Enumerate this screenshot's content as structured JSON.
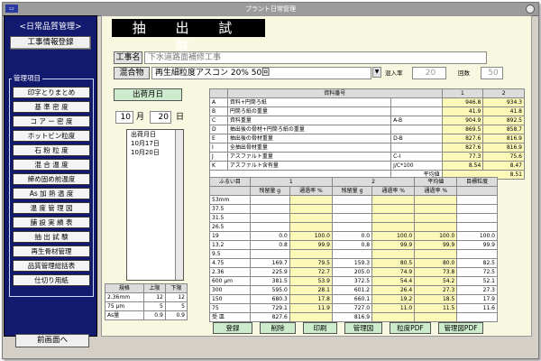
{
  "window": {
    "title": "プラント日常管理"
  },
  "sidebar": {
    "title": "<日常品質管理>",
    "register_button": "工事情報登録",
    "menu_label": "管理項目",
    "items": [
      "印字とりまとめ",
      "基 準 密 度",
      "コ ア ー 密 度",
      "ホットビン粒度",
      "石 粉 粒 度",
      "混 合 温 度",
      "締め固め前温度",
      "As 加 熱 温 度",
      "温 度 管 理 図",
      "舗 設 実 績 表",
      "抽 出 試 験",
      "再生骨材管理",
      "品質管理総括表",
      "仕切り用紙"
    ],
    "back_button": "前画面へ"
  },
  "header": {
    "title": "抽 出 試 験"
  },
  "fields": {
    "construction_label": "工事名",
    "construction_value": "下水道路面補修工事",
    "mix_label": "混合物",
    "mix_value": "再生細粒度アスコン 20% 50回",
    "mix_rate_label": "混入率",
    "mix_rate_value": "20",
    "count_label": "回数",
    "count_value": "50"
  },
  "shipment": {
    "label": "出荷月日",
    "month": "10",
    "month_unit": "月",
    "day": "20",
    "day_unit": "日",
    "list_header": "出荷月日",
    "list_items": [
      "10月17日",
      "10月20日"
    ]
  },
  "spec_table": {
    "headers": [
      "規格",
      "上限",
      "下限"
    ],
    "rows": [
      [
        "2.36mm",
        "12",
        "12"
      ],
      [
        "75 μm",
        "5",
        "5"
      ],
      [
        "As量",
        "0.9",
        "0.9"
      ]
    ]
  },
  "sample_table": {
    "header_label": "資料番号",
    "col_headers": [
      "1",
      "2"
    ],
    "rows": [
      {
        "key": "A",
        "label": "資料+円筒ろ紙",
        "formula": "",
        "v1": "946.8",
        "v2": "934.3"
      },
      {
        "key": "B",
        "label": "円筒ろ紙の重量",
        "formula": "",
        "v1": "41.9",
        "v2": "41.8"
      },
      {
        "key": "C",
        "label": "資料重量",
        "formula": "A-B",
        "v1": "904.9",
        "v2": "892.5"
      },
      {
        "key": "D",
        "label": "抽出後の骨材+円筒ろ紙の重量",
        "formula": "",
        "v1": "869.5",
        "v2": "858.7"
      },
      {
        "key": "E",
        "label": "抽出後の骨材重量",
        "formula": "D-B",
        "v1": "827.6",
        "v2": "816.9"
      },
      {
        "key": "I",
        "label": "全抽出骨材重量",
        "formula": "",
        "v1": "827.6",
        "v2": "816.9"
      },
      {
        "key": "J",
        "label": "アスファルト重量",
        "formula": "C-I",
        "v1": "77.3",
        "v2": "75.6"
      },
      {
        "key": "K",
        "label": "アスファルト含有量",
        "formula": "J/C*100",
        "v1": "8.54",
        "v2": "8.47"
      }
    ],
    "average_label": "平均値",
    "average_value": "8.51"
  },
  "sieve_table": {
    "sieve_label": "ふるい目",
    "group1": "1",
    "group2": "2",
    "avg_label": "平均値",
    "target_label": "目標粒度",
    "sub_retained": "残留量 g",
    "sub_passing": "通過率 %",
    "rows": [
      {
        "size": "53mm",
        "r1": "",
        "p1": "",
        "r2": "",
        "p2": "",
        "avg": "",
        "target": ""
      },
      {
        "size": "37.5",
        "r1": "",
        "p1": "",
        "r2": "",
        "p2": "",
        "avg": "",
        "target": ""
      },
      {
        "size": "31.5",
        "r1": "",
        "p1": "",
        "r2": "",
        "p2": "",
        "avg": "",
        "target": ""
      },
      {
        "size": "26.5",
        "r1": "",
        "p1": "",
        "r2": "",
        "p2": "",
        "avg": "",
        "target": ""
      },
      {
        "size": "19",
        "r1": "0.0",
        "p1": "100.0",
        "r2": "0.0",
        "p2": "100.0",
        "avg": "100.0",
        "target": "100.0"
      },
      {
        "size": "13.2",
        "r1": "0.8",
        "p1": "99.9",
        "r2": "0.8",
        "p2": "99.9",
        "avg": "99.9",
        "target": "99.9"
      },
      {
        "size": "9.5",
        "r1": "",
        "p1": "",
        "r2": "",
        "p2": "",
        "avg": "",
        "target": ""
      },
      {
        "size": "4.75",
        "r1": "169.7",
        "p1": "79.5",
        "r2": "159.3",
        "p2": "80.5",
        "avg": "80.0",
        "target": "82.5"
      },
      {
        "size": "2.36",
        "r1": "225.9",
        "p1": "72.7",
        "r2": "205.0",
        "p2": "74.9",
        "avg": "73.8",
        "target": "72.5"
      },
      {
        "size": "600 μm",
        "r1": "381.5",
        "p1": "53.9",
        "r2": "372.5",
        "p2": "54.4",
        "avg": "54.2",
        "target": "52.1"
      },
      {
        "size": "300",
        "r1": "595.0",
        "p1": "28.1",
        "r2": "601.2",
        "p2": "26.4",
        "avg": "27.3",
        "target": "27.3"
      },
      {
        "size": "150",
        "r1": "680.3",
        "p1": "17.8",
        "r2": "660.1",
        "p2": "19.2",
        "avg": "18.5",
        "target": "17.9"
      },
      {
        "size": "75",
        "r1": "729.1",
        "p1": "11.9",
        "r2": "727.0",
        "p2": "11.0",
        "avg": "11.5",
        "target": "11.6"
      },
      {
        "size": "受 皿",
        "r1": "827.6",
        "p1": "",
        "r2": "816.9",
        "p2": "",
        "avg": "",
        "target": ""
      }
    ]
  },
  "bottom_buttons": [
    "登録",
    "削除",
    "印刷",
    "管理図",
    "粒度PDF",
    "管理図PDF"
  ]
}
